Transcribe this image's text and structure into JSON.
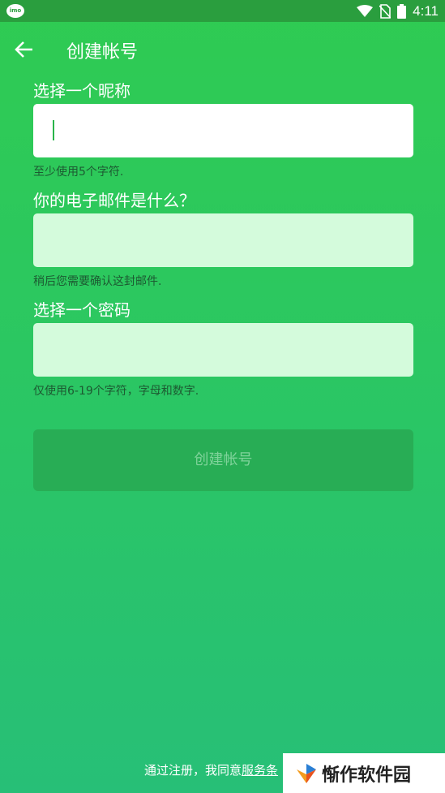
{
  "status_bar": {
    "app_icon": "imo-icon",
    "time": "4:11",
    "app_label": "imo"
  },
  "app_bar": {
    "title": "创建帐号",
    "back_icon": "arrow-left-icon"
  },
  "form": {
    "nickname": {
      "label": "选择一个昵称",
      "value": "",
      "hint": "至少使用5个字符."
    },
    "email": {
      "label": "你的电子邮件是什么？",
      "value": "",
      "hint": "稍后您需要确认这封邮件."
    },
    "password": {
      "label": "选择一个密码",
      "value": "",
      "hint": "仅使用6-19个字符，字母和数字."
    },
    "submit_label": "创建帐号"
  },
  "terms": {
    "prefix": "通过注册，我同意",
    "link": "服务条"
  },
  "watermark": {
    "text": "惭作软件园"
  },
  "colors": {
    "accent": "#2fcb52",
    "status_bar": "#2a9e3e",
    "input_idle": "#d4fbdc",
    "button": "#28ad55"
  }
}
